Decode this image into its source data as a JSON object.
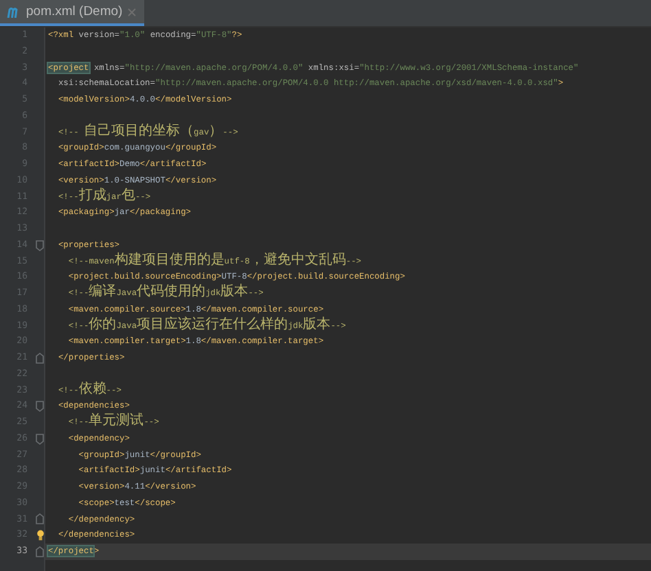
{
  "tabs": [
    {
      "label": "pom.xml (Demo)",
      "selected": true
    }
  ],
  "lines": [
    {
      "number": "1",
      "text": "<?xml version=\"1.0\" encoding=\"UTF-8\"?>",
      "current": false,
      "matched_tag": false
    },
    {
      "number": "2"
    },
    {
      "number": "3",
      "text": "<project xmlns=\"http://maven.apache.org/POM/4.0.0\" xmlns:xsi=\"http://www.w3.org/2001/XMLSchema-instance\"",
      "current": false,
      "matched_tag": true
    },
    {
      "number": "4",
      "text": "  xsi:schemaLocation=\"http://maven.apache.org/POM/4.0.0 http://maven.apache.org/xsd/maven-4.0.0.xsd\">",
      "current": false,
      "matched_tag": false
    },
    {
      "number": "5",
      "text": "  <modelVersion>4.0.0</modelVersion>",
      "current": false,
      "matched_tag": false
    },
    {
      "number": "6"
    },
    {
      "number": "7",
      "text": "  <!-- 自己项目的坐标（gav）-->",
      "current": false,
      "matched_tag": false
    },
    {
      "number": "8",
      "text": "  <groupId>com.guangyou</groupId>",
      "current": false,
      "matched_tag": false
    },
    {
      "number": "9",
      "text": "  <artifactId>Demo</artifactId>",
      "current": false,
      "matched_tag": false
    },
    {
      "number": "10",
      "text": "  <version>1.0-SNAPSHOT</version>",
      "current": false,
      "matched_tag": false
    },
    {
      "number": "11",
      "text": "  <!--打成jar包-->",
      "current": false,
      "matched_tag": false
    },
    {
      "number": "12",
      "text": "  <packaging>jar</packaging>",
      "current": false,
      "matched_tag": false
    },
    {
      "number": "13"
    },
    {
      "number": "14",
      "text": "  <properties>",
      "current": false,
      "matched_tag": false,
      "gutter_icon": {
        "kind": "fold-start"
      }
    },
    {
      "number": "15",
      "text": "    <!--maven构建项目使用的是utf-8，避免中文乱码-->",
      "current": false,
      "matched_tag": false
    },
    {
      "number": "16",
      "text": "    <project.build.sourceEncoding>UTF-8</project.build.sourceEncoding>",
      "current": false,
      "matched_tag": false
    },
    {
      "number": "17",
      "text": "    <!--编译Java代码使用的jdk版本-->",
      "current": false,
      "matched_tag": false
    },
    {
      "number": "18",
      "text": "    <maven.compiler.source>1.8</maven.compiler.source>",
      "current": false,
      "matched_tag": false
    },
    {
      "number": "19",
      "text": "    <!--你的Java项目应该运行在什么样的jdk版本-->",
      "current": false,
      "matched_tag": false
    },
    {
      "number": "20",
      "text": "    <maven.compiler.target>1.8</maven.compiler.target>",
      "current": false,
      "matched_tag": false
    },
    {
      "number": "21",
      "text": "  </properties>",
      "current": false,
      "matched_tag": false,
      "gutter_icon": {
        "kind": "fold-end"
      }
    },
    {
      "number": "22"
    },
    {
      "number": "23",
      "text": "  <!--依赖-->",
      "current": false,
      "matched_tag": false
    },
    {
      "number": "24",
      "text": "  <dependencies>",
      "current": false,
      "matched_tag": false,
      "gutter_icon": {
        "kind": "fold-start"
      }
    },
    {
      "number": "25",
      "text": "    <!--单元测试-->",
      "current": false,
      "matched_tag": false
    },
    {
      "number": "26",
      "text": "    <dependency>",
      "current": false,
      "matched_tag": false,
      "gutter_icon": {
        "kind": "fold-start"
      }
    },
    {
      "number": "27",
      "text": "      <groupId>junit</groupId>",
      "current": false,
      "matched_tag": false
    },
    {
      "number": "28",
      "text": "      <artifactId>junit</artifactId>",
      "current": false,
      "matched_tag": false
    },
    {
      "number": "29",
      "text": "      <version>4.11</version>",
      "current": false,
      "matched_tag": false
    },
    {
      "number": "30",
      "text": "      <scope>test</scope>",
      "current": false,
      "matched_tag": false
    },
    {
      "number": "31",
      "text": "    </dependency>",
      "current": false,
      "matched_tag": false,
      "gutter_icon": {
        "kind": "fold-end"
      }
    },
    {
      "number": "32",
      "text": "  </dependencies>",
      "current": false,
      "matched_tag": false,
      "gutter_icon": {
        "kind": "bulb"
      }
    },
    {
      "number": "33",
      "text": "</project>",
      "current": true,
      "matched_tag": true,
      "gutter_icon": {
        "kind": "fold-end"
      }
    }
  ]
}
